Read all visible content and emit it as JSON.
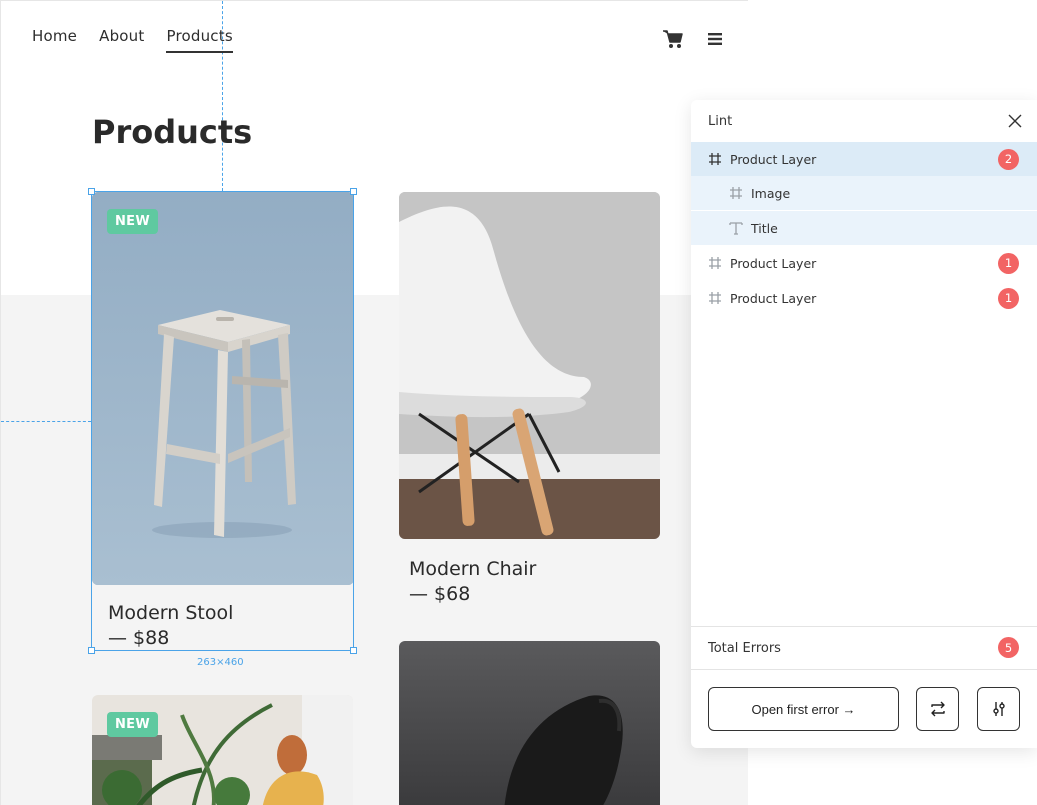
{
  "nav": {
    "items": [
      "Home",
      "About",
      "Products"
    ],
    "active": "Products",
    "cart_icon": "cart-icon",
    "menu_icon": "hamburger-menu-icon"
  },
  "page": {
    "title": "Products"
  },
  "products": [
    {
      "name": "Modern Stool",
      "price": "— $88",
      "badge": "NEW"
    },
    {
      "name": "Modern Chair",
      "price": "— $68"
    },
    {
      "badge": "NEW"
    },
    {}
  ],
  "selection": {
    "dimensions": "263×460"
  },
  "lint": {
    "title": "Lint",
    "items": [
      {
        "label": "Product Layer",
        "icon": "frame-icon",
        "errors": "2",
        "selected": true
      },
      {
        "label": "Image",
        "icon": "frame-icon",
        "child": true
      },
      {
        "label": "Title",
        "icon": "text-icon",
        "child": true
      },
      {
        "label": "Product Layer",
        "icon": "frame-icon",
        "errors": "1"
      },
      {
        "label": "Product Layer",
        "icon": "frame-icon",
        "errors": "1"
      }
    ],
    "total_label": "Total Errors",
    "total_count": "5",
    "open_first_error": "Open first error →"
  },
  "colors": {
    "accent": "#4aa3e8",
    "error": "#f26464",
    "badge": "#5fc9a0",
    "selected_row": "#dcebf7"
  }
}
